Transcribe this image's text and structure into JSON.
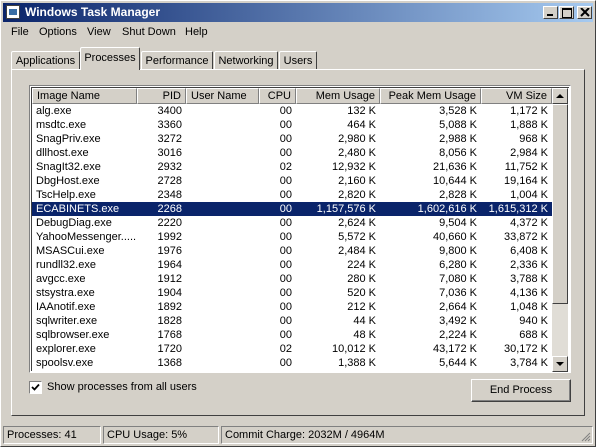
{
  "window": {
    "title": "Windows Task Manager",
    "title_buttons": [
      "minimize-icon",
      "maximize-icon",
      "close-icon"
    ]
  },
  "menu": [
    "File",
    "Options",
    "View",
    "Shut Down",
    "Help"
  ],
  "tabs": [
    {
      "label": "Applications",
      "active": false
    },
    {
      "label": "Processes",
      "active": true
    },
    {
      "label": "Performance",
      "active": false
    },
    {
      "label": "Networking",
      "active": false
    },
    {
      "label": "Users",
      "active": false
    }
  ],
  "columns": [
    "Image Name",
    "PID",
    "User Name",
    "CPU",
    "Mem Usage",
    "Peak Mem Usage",
    "VM Size"
  ],
  "processes": [
    {
      "name": "alg.exe",
      "pid": "3400",
      "user": "",
      "cpu": "00",
      "mem": "132 K",
      "peak": "3,528 K",
      "vm": "1,172 K"
    },
    {
      "name": "msdtc.exe",
      "pid": "3360",
      "user": "",
      "cpu": "00",
      "mem": "464 K",
      "peak": "5,088 K",
      "vm": "1,888 K"
    },
    {
      "name": "SnagPriv.exe",
      "pid": "3272",
      "user": "",
      "cpu": "00",
      "mem": "2,980 K",
      "peak": "2,988 K",
      "vm": "968 K"
    },
    {
      "name": "dllhost.exe",
      "pid": "3016",
      "user": "",
      "cpu": "00",
      "mem": "2,480 K",
      "peak": "8,056 K",
      "vm": "2,984 K"
    },
    {
      "name": "SnagIt32.exe",
      "pid": "2932",
      "user": "",
      "cpu": "02",
      "mem": "12,932 K",
      "peak": "21,636 K",
      "vm": "11,752 K"
    },
    {
      "name": "DbgHost.exe",
      "pid": "2728",
      "user": "",
      "cpu": "00",
      "mem": "2,160 K",
      "peak": "10,644 K",
      "vm": "19,164 K"
    },
    {
      "name": "TscHelp.exe",
      "pid": "2348",
      "user": "",
      "cpu": "00",
      "mem": "2,820 K",
      "peak": "2,828 K",
      "vm": "1,004 K"
    },
    {
      "name": "ECABINETS.exe",
      "pid": "2268",
      "user": "",
      "cpu": "00",
      "mem": "1,157,576 K",
      "peak": "1,602,616 K",
      "vm": "1,615,312 K",
      "selected": true
    },
    {
      "name": "DebugDiag.exe",
      "pid": "2220",
      "user": "",
      "cpu": "00",
      "mem": "2,624 K",
      "peak": "9,504 K",
      "vm": "4,372 K"
    },
    {
      "name": "YahooMessenger.....",
      "pid": "1992",
      "user": "",
      "cpu": "00",
      "mem": "5,572 K",
      "peak": "40,660 K",
      "vm": "33,872 K"
    },
    {
      "name": "MSASCui.exe",
      "pid": "1976",
      "user": "",
      "cpu": "00",
      "mem": "2,484 K",
      "peak": "9,800 K",
      "vm": "6,408 K"
    },
    {
      "name": "rundll32.exe",
      "pid": "1964",
      "user": "",
      "cpu": "00",
      "mem": "224 K",
      "peak": "6,280 K",
      "vm": "2,336 K"
    },
    {
      "name": "avgcc.exe",
      "pid": "1912",
      "user": "",
      "cpu": "00",
      "mem": "280 K",
      "peak": "7,080 K",
      "vm": "3,788 K"
    },
    {
      "name": "stsystra.exe",
      "pid": "1904",
      "user": "",
      "cpu": "00",
      "mem": "520 K",
      "peak": "7,036 K",
      "vm": "4,136 K"
    },
    {
      "name": "IAAnotif.exe",
      "pid": "1892",
      "user": "",
      "cpu": "00",
      "mem": "212 K",
      "peak": "2,664 K",
      "vm": "1,048 K"
    },
    {
      "name": "sqlwriter.exe",
      "pid": "1828",
      "user": "",
      "cpu": "00",
      "mem": "44 K",
      "peak": "3,492 K",
      "vm": "940 K"
    },
    {
      "name": "sqlbrowser.exe",
      "pid": "1768",
      "user": "",
      "cpu": "00",
      "mem": "48 K",
      "peak": "2,224 K",
      "vm": "688 K"
    },
    {
      "name": "explorer.exe",
      "pid": "1720",
      "user": "",
      "cpu": "02",
      "mem": "10,012 K",
      "peak": "43,172 K",
      "vm": "30,172 K"
    },
    {
      "name": "spoolsv.exe",
      "pid": "1368",
      "user": "",
      "cpu": "00",
      "mem": "1,388 K",
      "peak": "5,644 K",
      "vm": "3,784 K"
    }
  ],
  "show_all_users": {
    "label": "Show processes from all users",
    "checked": true
  },
  "end_process_label": "End Process",
  "status": {
    "processes": "Processes: 41",
    "cpu": "CPU Usage: 5%",
    "commit": "Commit Charge: 2032M / 4964M"
  },
  "colors": {
    "selection": "#0a246a",
    "titlebar_start": "#0a246a",
    "titlebar_end": "#a6caf0",
    "face": "#d4d0c8"
  }
}
